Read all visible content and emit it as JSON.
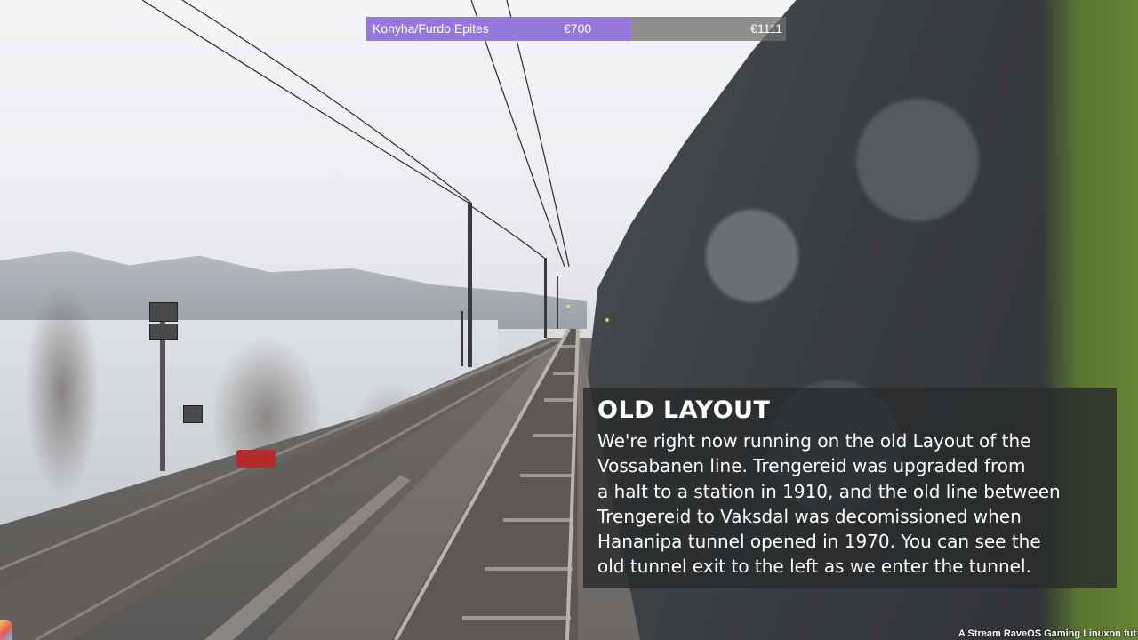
{
  "goal_bar": {
    "label": "Konyha/Furdo Epites",
    "current": "€700",
    "target": "€1111",
    "progress": 0.63,
    "fill_color": "#9678dc"
  },
  "info_panel": {
    "title": "OLD LAYOUT",
    "lines": [
      "We're right now running on the old Layout of the",
      "Vossabanen line. Trengereid was upgraded from",
      "a halt to a station in 1910, and the old line between",
      "Trengereid to Vaksdal was decomissioned when",
      "Hananipa tunnel opened in 1970. You can see the",
      "old tunnel exit to the left as we enter the tunnel."
    ]
  },
  "footer": {
    "credit": "A Stream RaveOS Gaming Linuxon fut"
  },
  "icons": {
    "corner_logo": "app-logo-icon"
  }
}
